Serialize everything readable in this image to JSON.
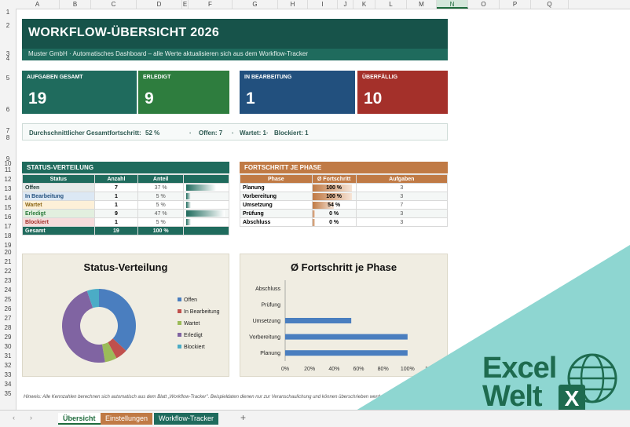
{
  "columns": [
    "A",
    "B",
    "C",
    "D",
    "E",
    "F",
    "G",
    "H",
    "I",
    "J",
    "K",
    "L",
    "M",
    "N",
    "O",
    "P",
    "Q"
  ],
  "selected_column": "N",
  "rows": [
    "1",
    "2",
    "3",
    "4",
    "5",
    "6",
    "7",
    "8",
    "9",
    "10",
    "11",
    "12",
    "13",
    "14",
    "15",
    "16",
    "17",
    "18",
    "19",
    "20",
    "21",
    "22",
    "23",
    "24",
    "25",
    "26",
    "27",
    "28",
    "29",
    "30",
    "31",
    "32",
    "33",
    "34",
    "35"
  ],
  "header": {
    "title": "WORKFLOW-ÜBERSICHT 2026",
    "subtitle": "Muster GmbH  ·  Automatisches Dashboard – alle Werte aktualisieren sich aus dem Workflow-Tracker"
  },
  "kpis": [
    {
      "label": "AUFGABEN GESAMT",
      "value": "19",
      "color": "#1f6b5d"
    },
    {
      "label": "ERLEDIGT",
      "value": "9",
      "color": "#2e7d3e"
    },
    {
      "label": "IN BEARBEITUNG",
      "value": "1",
      "color": "#22507e"
    },
    {
      "label": "ÜBERFÄLLIG",
      "value": "10",
      "color": "#a4302a"
    }
  ],
  "progress_line": {
    "label": "Durchschnittlicher Gesamtfortschritt:",
    "value": "52 %",
    "sep1": "·",
    "open": "Offen: 7",
    "sep2": "·",
    "waiting": "Wartet: 1",
    "sep3": "·",
    "blocked": "Blockiert: 1"
  },
  "status_table": {
    "title": "STATUS-VERTEILUNG",
    "headers": [
      "Status",
      "Anzahl",
      "Anteil"
    ],
    "rows": [
      {
        "status": "Offen",
        "count": "7",
        "share": "37 %",
        "fill": 0.37,
        "bg": "#e6ebea",
        "fg": "#1f3b36"
      },
      {
        "status": "In Bearbeitung",
        "count": "1",
        "share": "5 %",
        "fill": 0.05,
        "bg": "#dce8f4",
        "fg": "#22507e"
      },
      {
        "status": "Wartet",
        "count": "1",
        "share": "5 %",
        "fill": 0.05,
        "bg": "#fdf0d8",
        "fg": "#8a6412"
      },
      {
        "status": "Erledigt",
        "count": "9",
        "share": "47 %",
        "fill": 0.47,
        "bg": "#e2efdf",
        "fg": "#2e7d3e"
      },
      {
        "status": "Blockiert",
        "count": "1",
        "share": "5 %",
        "fill": 0.05,
        "bg": "#f6dcdc",
        "fg": "#a4302a"
      }
    ],
    "total": {
      "label": "Gesamt",
      "count": "19",
      "share": "100 %"
    }
  },
  "phase_table": {
    "title": "FORTSCHRITT JE PHASE",
    "headers": [
      "Phase",
      "Ø Fortschritt",
      "Aufgaben"
    ],
    "rows": [
      {
        "phase": "Planung",
        "progress": "100 %",
        "fill": 1.0,
        "tasks": "3"
      },
      {
        "phase": "Vorbereitung",
        "progress": "100 %",
        "fill": 1.0,
        "tasks": "3"
      },
      {
        "phase": "Umsetzung",
        "progress": "54 %",
        "fill": 0.54,
        "tasks": "7"
      },
      {
        "phase": "Prüfung",
        "progress": "0 %",
        "fill": 0.0,
        "tasks": "3"
      },
      {
        "phase": "Abschluss",
        "progress": "0 %",
        "fill": 0.0,
        "tasks": "3"
      }
    ]
  },
  "chart_data": [
    {
      "type": "pie",
      "title": "Status-Verteilung",
      "categories": [
        "Offen",
        "In Bearbeitung",
        "Wartet",
        "Erledigt",
        "Blockiert"
      ],
      "values": [
        7,
        1,
        1,
        9,
        1
      ],
      "colors": [
        "#4a7ebf",
        "#c0504d",
        "#9bbb59",
        "#8064a2",
        "#4bacc6"
      ],
      "legend": "right"
    },
    {
      "type": "bar",
      "title": "Ø Fortschritt je Phase",
      "categories": [
        "Planung",
        "Vorbereitung",
        "Umsetzung",
        "Prüfung",
        "Abschluss"
      ],
      "values": [
        100,
        100,
        54,
        0,
        0
      ],
      "xticks": [
        "0%",
        "20%",
        "40%",
        "60%",
        "80%",
        "100%",
        "120%"
      ],
      "xlim": [
        0,
        120
      ],
      "color": "#4a7ebf"
    }
  ],
  "hint": "Hinweis: Alle Kennzahlen berechnen sich automatisch aus dem Blatt „Workflow-Tracker\". Beispieldaten dienen nur zur Veranschaulichung und können überschrieben werden.",
  "sheet_tabs": [
    {
      "label": "Übersicht",
      "active": true,
      "color": "#d9d9d9"
    },
    {
      "label": "Einstellungen",
      "active": false,
      "color": "#c07a45"
    },
    {
      "label": "Workflow-Tracker",
      "active": false,
      "color": "#1f6b5d"
    }
  ],
  "logo": {
    "line1": "Excel",
    "line2": "Welt",
    "badge": "X",
    "color": "#1e6b4f"
  }
}
